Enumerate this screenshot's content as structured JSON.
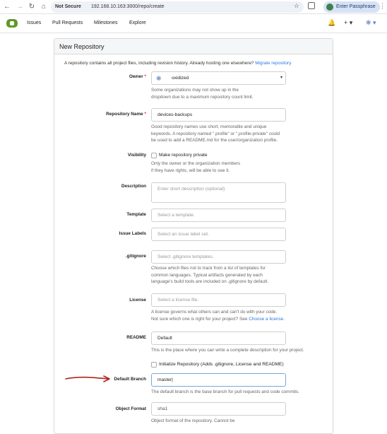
{
  "browser": {
    "security_label": "Not Secure",
    "url": "192.168.10.163:3000/repo/create",
    "passphrase_button": "Enter Passphrase"
  },
  "nav": {
    "items": [
      "Issues",
      "Pull Requests",
      "Milestones",
      "Explore"
    ],
    "plus_label": "+",
    "bell_icon": "bell-icon"
  },
  "form": {
    "title": "New Repository",
    "intro_text": "A repository contains all project files, including revision history. Already hosting one elsewhere?",
    "intro_link": "Migrate repository.",
    "owner": {
      "label": "Owner",
      "value": "oxidized",
      "help": [
        "Some organizations may not show up in the",
        "dropdown due to a maximum repository count limit."
      ]
    },
    "repo_name": {
      "label": "Repository Name",
      "value": "devices-backups",
      "help": [
        "Good repository names use short, memorable and unique",
        "keywords. A repository named \".profile\" or \".profile-private\" could",
        "be used to add a README.md for the user/organization profile."
      ]
    },
    "visibility": {
      "label": "Visibility",
      "checkbox_label": "Make repository private",
      "help": [
        "Only the owner or the organization members",
        "if they have rights, will be able to see it."
      ]
    },
    "description": {
      "label": "Description",
      "placeholder": "Enter short description (optional)"
    },
    "template": {
      "label": "Template",
      "placeholder": "Select a template."
    },
    "issue_labels": {
      "label": "Issue Labels",
      "placeholder": "Select an issue label set."
    },
    "gitignore": {
      "label": ".gitignore",
      "placeholder": "Select .gitignore templates.",
      "help": [
        "Choose which files not to track from a list of templates for",
        "common languages. Typical artifacts generated by each",
        "language's build tools are included on .gitignore by default."
      ]
    },
    "license": {
      "label": "License",
      "placeholder": "Select a license file.",
      "help_line1": "A license governs what others can and can't do with your code.",
      "help_line2": "Not sure which one is right for your project? See",
      "help_link": "Choose a license."
    },
    "readme": {
      "label": "README",
      "value": "Default",
      "help": "This is the place where you can write a complete description for your project."
    },
    "initialize": {
      "checkbox_label": "Initialize Repository (Adds .gitignore, License and README)"
    },
    "default_branch": {
      "label": "Default Branch",
      "value": "master",
      "help": "The default branch is the base branch for pull requests and code commits."
    },
    "object_format": {
      "label": "Object Format",
      "value": "sha1",
      "help": "Object format of the repository. Cannot be"
    }
  }
}
